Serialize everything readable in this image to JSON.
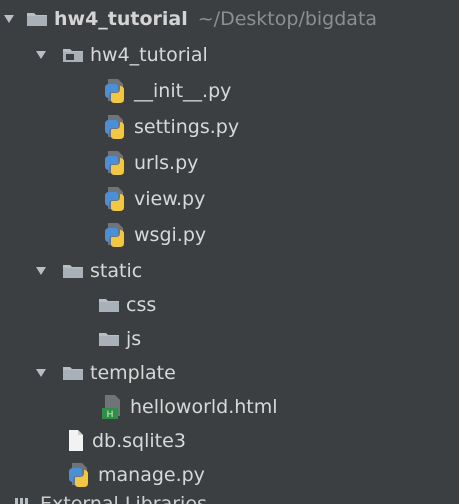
{
  "tree": {
    "root": {
      "name": "hw4_tutorial",
      "path": "~/Desktop/bigdata"
    },
    "items": [
      {
        "label": "hw4_tutorial",
        "type": "folder"
      },
      {
        "label": "__init__.py",
        "type": "python"
      },
      {
        "label": "settings.py",
        "type": "python"
      },
      {
        "label": "urls.py",
        "type": "python"
      },
      {
        "label": "view.py",
        "type": "python"
      },
      {
        "label": "wsgi.py",
        "type": "python"
      },
      {
        "label": "static",
        "type": "folder"
      },
      {
        "label": "css",
        "type": "folder"
      },
      {
        "label": "js",
        "type": "folder"
      },
      {
        "label": "template",
        "type": "folder"
      },
      {
        "label": "helloworld.html",
        "type": "html"
      },
      {
        "label": "db.sqlite3",
        "type": "file"
      },
      {
        "label": "manage.py",
        "type": "python"
      }
    ],
    "bottom_partial": "External Libraries"
  },
  "colors": {
    "background": "#3c3f41",
    "text": "#d8d8d8",
    "path_text": "#8e8e8e",
    "folder_icon": "#b9bec4",
    "python_blue": "#4a90d9",
    "python_yellow": "#f2c744",
    "html_green": "#2f8f46"
  },
  "icons": {
    "expand": "chevron-down-icon",
    "folder": "folder-icon",
    "python": "python-file-icon",
    "html": "html-file-icon",
    "file": "file-icon"
  }
}
